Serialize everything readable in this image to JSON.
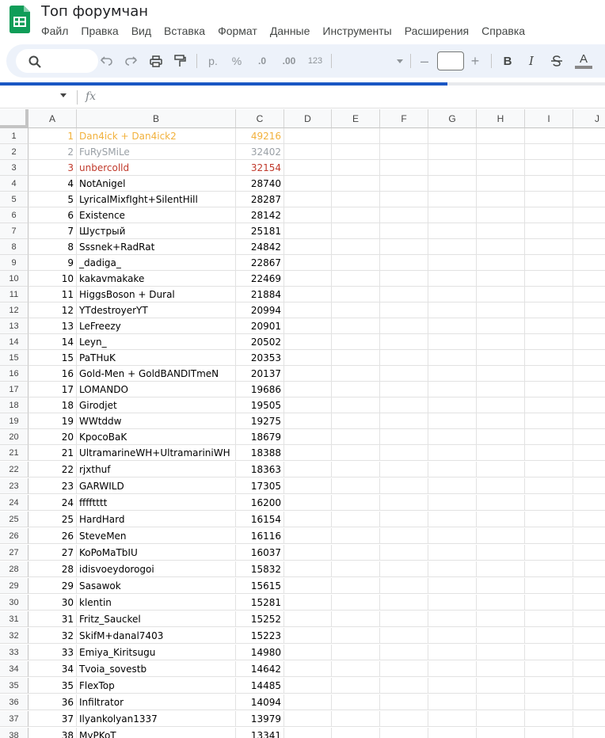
{
  "document": {
    "title": "Топ форумчан"
  },
  "menu": [
    "Файл",
    "Правка",
    "Вид",
    "Вставка",
    "Формат",
    "Данные",
    "Инструменты",
    "Расширения",
    "Справка"
  ],
  "toolbar": {
    "currency_label": "р.",
    "percent_label": "%",
    "decrease_decimals_label": ".0",
    "increase_decimals_label": ".00",
    "number_format_label": "123",
    "minus_label": "–",
    "plus_label": "+",
    "bold_label": "B",
    "italic_label": "I",
    "text_color_label": "A"
  },
  "loading_progress": 0.74,
  "formula_bar": {
    "fx_label": "fx"
  },
  "columns": [
    "A",
    "B",
    "C",
    "D",
    "E",
    "F",
    "G",
    "H",
    "I",
    "J"
  ],
  "colors": {
    "gold": "#f2b13c",
    "silver": "#9aa0a6",
    "bronze": "#c0392b",
    "accent": "#1a57c4"
  },
  "rows": [
    {
      "n": "1",
      "a": "1",
      "b": "Dan4ick + Dan4ick2",
      "c": "49216",
      "color": "#f2b13c"
    },
    {
      "n": "2",
      "a": "2",
      "b": "FuRySMiLe",
      "c": "32402",
      "color": "#9aa0a6"
    },
    {
      "n": "3",
      "a": "3",
      "b": "unbercolld",
      "c": "32154",
      "color": "#c0392b"
    },
    {
      "n": "4",
      "a": "4",
      "b": "NotAnigel",
      "c": "28740"
    },
    {
      "n": "5",
      "a": "5",
      "b": "LyricalMixfIght+SilentHill",
      "c": "28287"
    },
    {
      "n": "6",
      "a": "6",
      "b": "Existence",
      "c": "28142"
    },
    {
      "n": "7",
      "a": "7",
      "b": "Шустрый",
      "c": "25181"
    },
    {
      "n": "8",
      "a": "8",
      "b": "Sssnek+RadRat",
      "c": "24842"
    },
    {
      "n": "9",
      "a": "9",
      "b": "_dadiga_",
      "c": "22867"
    },
    {
      "n": "10",
      "a": "10",
      "b": "kakavmakake",
      "c": "22469"
    },
    {
      "n": "11",
      "a": "11",
      "b": "HiggsBoson + Dural",
      "c": "21884"
    },
    {
      "n": "12",
      "a": "12",
      "b": "YTdestroyerYT",
      "c": "20994"
    },
    {
      "n": "13",
      "a": "13",
      "b": "LeFreezy",
      "c": "20901"
    },
    {
      "n": "14",
      "a": "14",
      "b": "Leyn_",
      "c": "20502"
    },
    {
      "n": "15",
      "a": "15",
      "b": "PaTHuK",
      "c": "20353"
    },
    {
      "n": "16",
      "a": "16",
      "b": "Gold-Men + GoldBANDITmeN",
      "c": "20137"
    },
    {
      "n": "17",
      "a": "17",
      "b": "LOMANDO",
      "c": "19686"
    },
    {
      "n": "18",
      "a": "18",
      "b": "Girodjet",
      "c": "19505"
    },
    {
      "n": "19",
      "a": "19",
      "b": "WWtddw",
      "c": "19275"
    },
    {
      "n": "20",
      "a": "20",
      "b": "KpocoBaK",
      "c": "18679"
    },
    {
      "n": "21",
      "a": "21",
      "b": "UltramarineWH+UltramariniWH",
      "c": "18388"
    },
    {
      "n": "22",
      "a": "22",
      "b": "rjxthuf",
      "c": "18363"
    },
    {
      "n": "23",
      "a": "23",
      "b": "GARWILD",
      "c": "17305"
    },
    {
      "n": "24",
      "a": "24",
      "b": "fffftttt",
      "c": "16200"
    },
    {
      "n": "25",
      "a": "25",
      "b": "HardHard",
      "c": "16154"
    },
    {
      "n": "26",
      "a": "26",
      "b": "SteveMen",
      "c": "16116"
    },
    {
      "n": "27",
      "a": "27",
      "b": "KoPoMaTbIU",
      "c": "16037"
    },
    {
      "n": "28",
      "a": "28",
      "b": "idisvoeydorogoi",
      "c": "15832"
    },
    {
      "n": "29",
      "a": "29",
      "b": "Sasawok",
      "c": "15615"
    },
    {
      "n": "30",
      "a": "30",
      "b": "klentin",
      "c": "15281"
    },
    {
      "n": "31",
      "a": "31",
      "b": "Fritz_Sauckel",
      "c": "15252"
    },
    {
      "n": "32",
      "a": "32",
      "b": "SkifM+danal7403",
      "c": "15223"
    },
    {
      "n": "33",
      "a": "33",
      "b": "Emiya_Kiritsugu",
      "c": "14980"
    },
    {
      "n": "34",
      "a": "34",
      "b": "Tvoia_sovestb",
      "c": "14642"
    },
    {
      "n": "35",
      "a": "35",
      "b": "FlexTop",
      "c": "14485"
    },
    {
      "n": "36",
      "a": "36",
      "b": "Infiltrator",
      "c": "14094"
    },
    {
      "n": "37",
      "a": "37",
      "b": "Ilyankolyan1337",
      "c": "13979"
    },
    {
      "n": "38",
      "a": "38",
      "b": "MyPKoT",
      "c": "13341"
    }
  ]
}
